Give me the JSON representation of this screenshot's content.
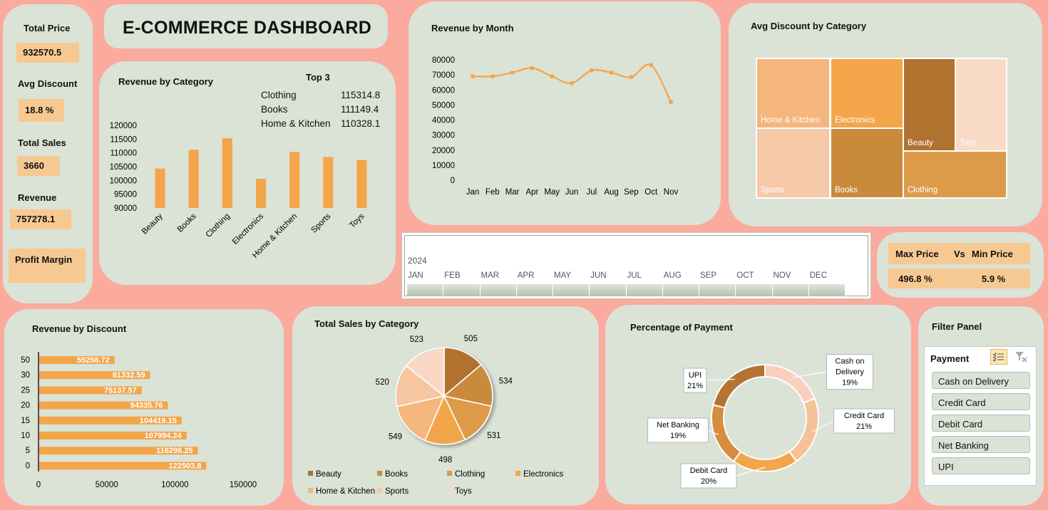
{
  "title": "E-COMMERCE DASHBOARD",
  "kpis": {
    "total_price_label": "Total Price",
    "total_price": "932570.5",
    "avg_discount_label": "Avg Discount",
    "avg_discount": "18.8 %",
    "total_sales_label": "Total Sales",
    "total_sales": "3660",
    "revenue_label": "Revenue",
    "revenue": "757278.1",
    "profit_margin_label": "Profit Margin"
  },
  "colors": {
    "background": "#fbaa9e",
    "panel": "#dbe2d6",
    "accent": "#f3a54a",
    "kpi": "#f7c992"
  },
  "revenue_by_category": {
    "title": "Revenue by Category",
    "top3_title": "Top 3",
    "top3": [
      {
        "name": "Clothing",
        "value": "115314.8"
      },
      {
        "name": "Books",
        "value": "111149.4"
      },
      {
        "name": "Home & Kitchen",
        "value": "110328.1"
      }
    ]
  },
  "revenue_by_month": {
    "title": "Revenue by Month"
  },
  "avg_discount_by_category": {
    "title": "Avg Discount by Category",
    "cells": [
      "Home & Kitchen",
      "Electronics",
      "Beauty",
      "Toys",
      "Sports",
      "Books",
      "Clothing"
    ]
  },
  "timeline": {
    "year": "2024",
    "months": [
      "JAN",
      "FEB",
      "MAR",
      "APR",
      "MAY",
      "JUN",
      "JUL",
      "AUG",
      "SEP",
      "OCT",
      "NOV",
      "DEC"
    ]
  },
  "max_min": {
    "max_label": "Max Price",
    "vs_label": "Vs",
    "min_label": "Min Price",
    "max_value": "496.8 %",
    "min_value": "5.9 %"
  },
  "revenue_by_discount": {
    "title": "Revenue by Discount"
  },
  "total_sales_by_category": {
    "title": "Total Sales by Category"
  },
  "percentage_of_payment": {
    "title": "Percentage of Payment"
  },
  "filter_panel": {
    "title": "Filter Panel",
    "header": "Payment",
    "items": [
      "Cash on Delivery",
      "Credit Card",
      "Debit Card",
      "Net Banking",
      "UPI"
    ]
  },
  "chart_data": [
    {
      "type": "bar",
      "title": "Revenue by Category",
      "categories": [
        "Beauty",
        "Books",
        "Clothing",
        "Electronics",
        "Home & Kitchen",
        "Sports",
        "Toys"
      ],
      "values": [
        104300,
        111149.4,
        115314.8,
        100600,
        110328.1,
        108500,
        107400
      ],
      "ylim": [
        90000,
        120000
      ],
      "yticks": [
        "90000",
        "95000",
        "100000",
        "105000",
        "110000",
        "115000",
        "120000"
      ],
      "color": "#f3a54a",
      "grid": false
    },
    {
      "type": "line",
      "title": "Revenue by Month",
      "categories": [
        "Jan",
        "Feb",
        "Mar",
        "Apr",
        "May",
        "Jun",
        "Jul",
        "Aug",
        "Sep",
        "Oct",
        "Nov"
      ],
      "values": [
        69000,
        69000,
        71500,
        74500,
        69000,
        64500,
        73000,
        71500,
        68500,
        76500,
        52000
      ],
      "ylim": [
        0,
        80000
      ],
      "yticks": [
        "0",
        "10000",
        "20000",
        "30000",
        "40000",
        "50000",
        "60000",
        "70000",
        "80000"
      ],
      "color": "#f3a54a",
      "grid": false
    },
    {
      "type": "bar",
      "orientation": "horizontal",
      "title": "Revenue by Discount",
      "categories": [
        "50",
        "30",
        "25",
        "20",
        "15",
        "10",
        "5",
        "0"
      ],
      "values": [
        55258.72,
        81332.59,
        75137.57,
        94335.76,
        104419.15,
        107994.24,
        116296.25,
        122503.8
      ],
      "labels": [
        "55258.72",
        "81332.59",
        "75137.57",
        "94335.76",
        "104419.15",
        "107994.24",
        "116296.25",
        "122503.8"
      ],
      "xlim": [
        0,
        150000
      ],
      "xticks": [
        "0",
        "50000",
        "100000",
        "150000"
      ],
      "color": "#f3a54a"
    },
    {
      "type": "pie",
      "title": "Total Sales by Category",
      "categories": [
        "Beauty",
        "Books",
        "Clothing",
        "Electronics",
        "Home & Kitchen",
        "Sports",
        "Toys"
      ],
      "values": [
        505,
        534,
        531,
        498,
        549,
        520,
        523
      ],
      "colors": [
        "#b0722f",
        "#ca8a3c",
        "#dd9a48",
        "#f3a54a",
        "#f4b87c",
        "#f6c6a0",
        "#f8d8c4"
      ],
      "legend": "bottom"
    },
    {
      "type": "pie",
      "variant": "donut",
      "title": "Percentage of Payment",
      "categories": [
        "Cash on Delivery",
        "Credit Card",
        "Debit Card",
        "Net Banking",
        "UPI"
      ],
      "values": [
        19,
        21,
        20,
        19,
        21
      ],
      "labels": [
        "19%",
        "21%",
        "20%",
        "19%",
        "21%"
      ],
      "colors": [
        "#f8d0bc",
        "#f6c197",
        "#f3a54a",
        "#d58e3f",
        "#b47432"
      ]
    }
  ]
}
